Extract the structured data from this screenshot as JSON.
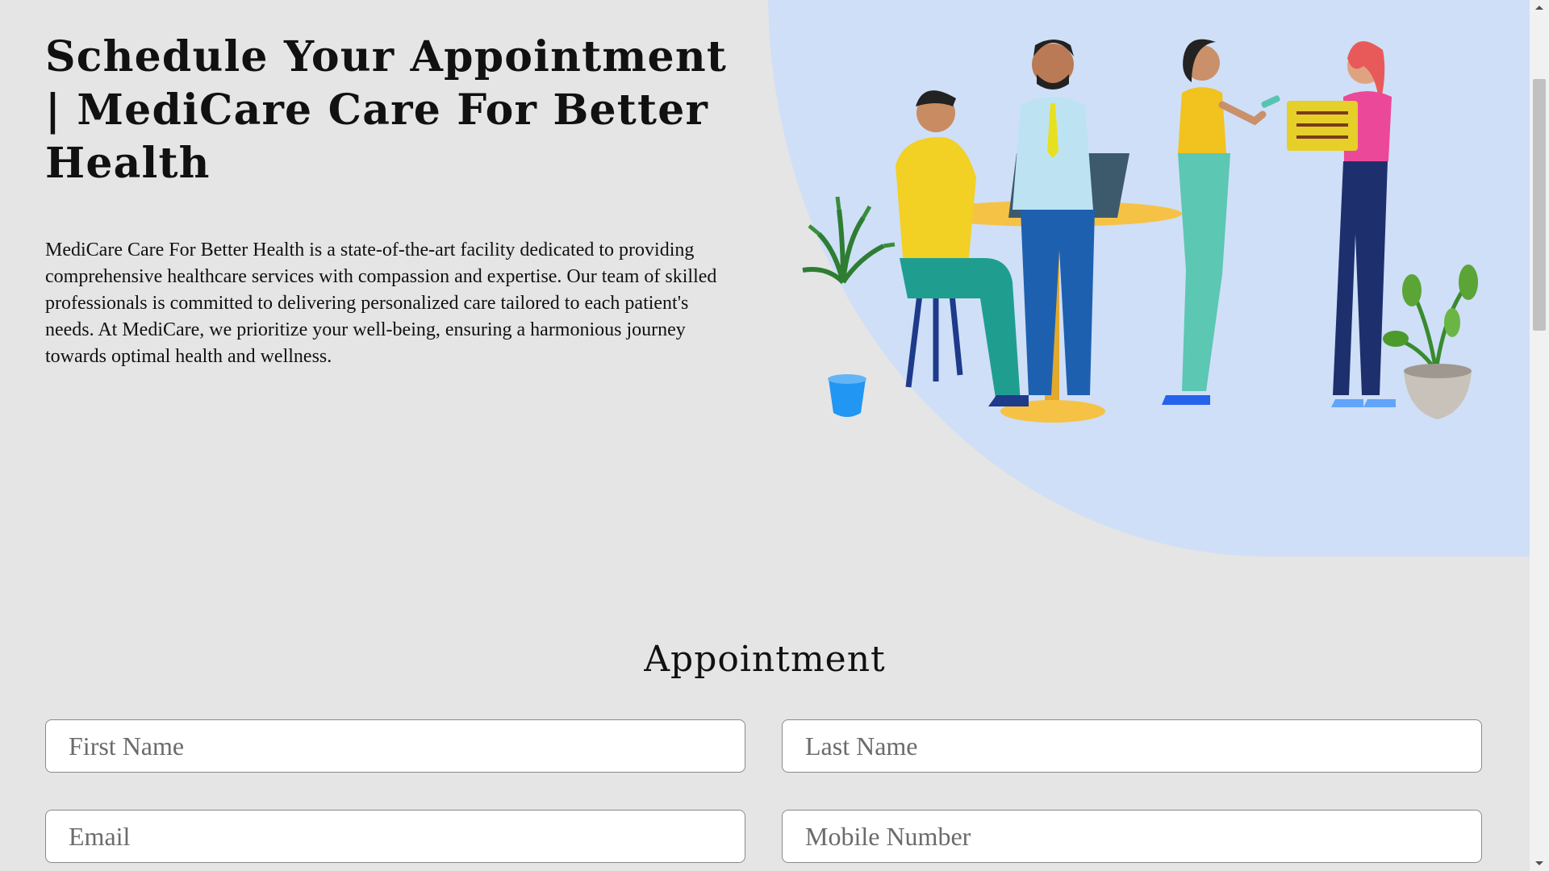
{
  "hero": {
    "title": "Schedule Your Appointment | MediCare Care For Better Health",
    "description": "MediCare Care For Better Health is a state-of-the-art facility dedicated to providing comprehensive healthcare services with compassion and expertise. Our team of skilled professionals is committed to delivering personalized care tailored to each patient's needs. At MediCare, we prioritize your well-being, ensuring a harmonious journey towards optimal health and wellness."
  },
  "form": {
    "title": "Appointment",
    "first_name_placeholder": "First Name",
    "last_name_placeholder": "Last Name",
    "email_placeholder": "Email",
    "mobile_placeholder": "Mobile Number"
  },
  "colors": {
    "background": "#e5e5e5",
    "hero_blob": "#cfdff7",
    "field_border": "#8a8a8a"
  },
  "icons": [
    "team-illustration",
    "scroll-up-arrow-icon",
    "scroll-down-arrow-icon"
  ]
}
